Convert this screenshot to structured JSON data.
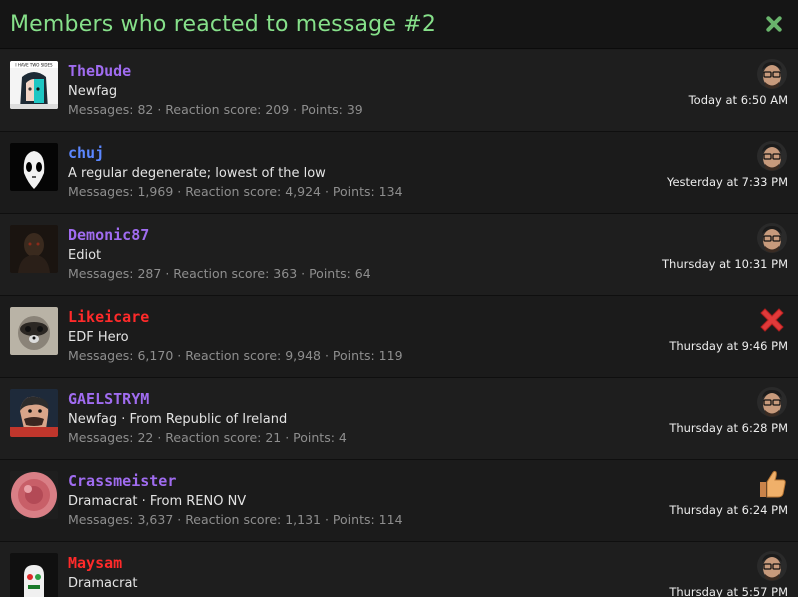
{
  "header": {
    "title": "Members who reacted to message #2"
  },
  "members": [
    {
      "name": "TheDude",
      "name_color": "#a06cf0",
      "title": "Newfag",
      "stats": "Messages: 82 · Reaction score: 209 · Points: 39",
      "time": "Today at 6:50 AM",
      "reaction": "face",
      "avatar_text": "I HAVE TWO SIDES"
    },
    {
      "name": "chuj",
      "name_color": "#5b87ff",
      "title": "A regular degenerate; lowest of the low",
      "stats": "Messages: 1,969 · Reaction score: 4,924 · Points: 134",
      "time": "Yesterday at 7:33 PM",
      "reaction": "face",
      "avatar_text": ""
    },
    {
      "name": "Demonic87",
      "name_color": "#a06cf0",
      "title": "Ediot",
      "stats": "Messages: 287 · Reaction score: 363 · Points: 64",
      "time": "Thursday at 10:31 PM",
      "reaction": "face",
      "avatar_text": ""
    },
    {
      "name": "Likeicare",
      "name_color": "#ff2a2a",
      "title": "EDF Hero",
      "stats": "Messages: 6,170 · Reaction score: 9,948 · Points: 119",
      "time": "Thursday at 9:46 PM",
      "reaction": "x",
      "avatar_text": ""
    },
    {
      "name": "GAELSTRYM",
      "name_color": "#a06cf0",
      "title": "Newfag · From Republic of Ireland",
      "stats": "Messages: 22 · Reaction score: 21 · Points: 4",
      "time": "Thursday at 6:28 PM",
      "reaction": "face",
      "avatar_text": ""
    },
    {
      "name": "Crassmeister",
      "name_color": "#a06cf0",
      "title": "Dramacrat · From RENO NV",
      "stats": "Messages: 3,637 · Reaction score: 1,131 · Points: 114",
      "time": "Thursday at 6:24 PM",
      "reaction": "thumb",
      "avatar_text": ""
    },
    {
      "name": "Maysam",
      "name_color": "#ff2a2a",
      "title": "Dramacrat",
      "stats": "",
      "time": "Thursday at 5:57 PM",
      "reaction": "face",
      "avatar_text": ""
    }
  ],
  "icons": {
    "close": "close-icon",
    "face": "face-reaction-icon",
    "x": "x-reaction-icon",
    "thumb": "thumbs-up-icon"
  }
}
